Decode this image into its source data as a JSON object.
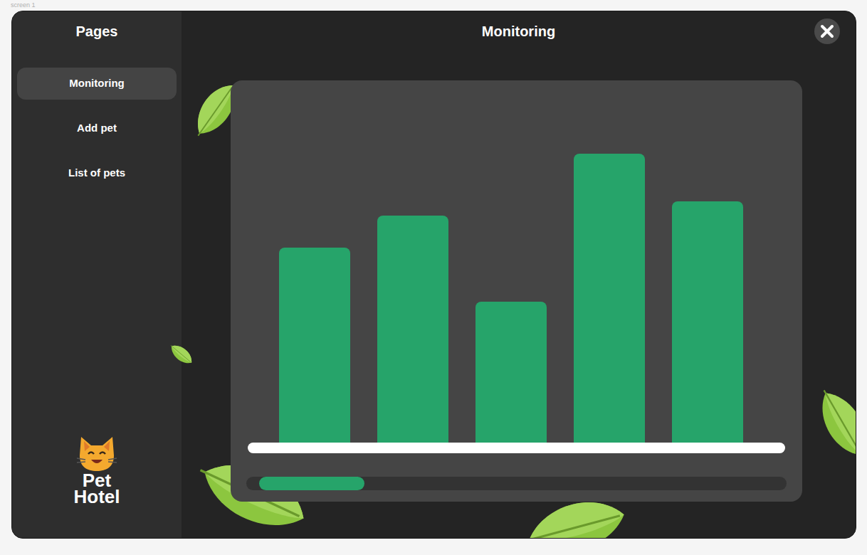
{
  "frame_label": "screen 1",
  "sidebar": {
    "title": "Pages",
    "items": [
      {
        "label": "Monitoring",
        "selected": true
      },
      {
        "label": "Add pet",
        "selected": false
      },
      {
        "label": "List of pets",
        "selected": false
      }
    ],
    "logo": {
      "text": "Pet Hotel"
    }
  },
  "page": {
    "title": "Monitoring"
  },
  "chart": {
    "series": [
      {
        "values": [
          274,
          319,
          198,
          406,
          339
        ]
      }
    ]
  },
  "scrollbar": {
    "level": 0.2
  }
}
